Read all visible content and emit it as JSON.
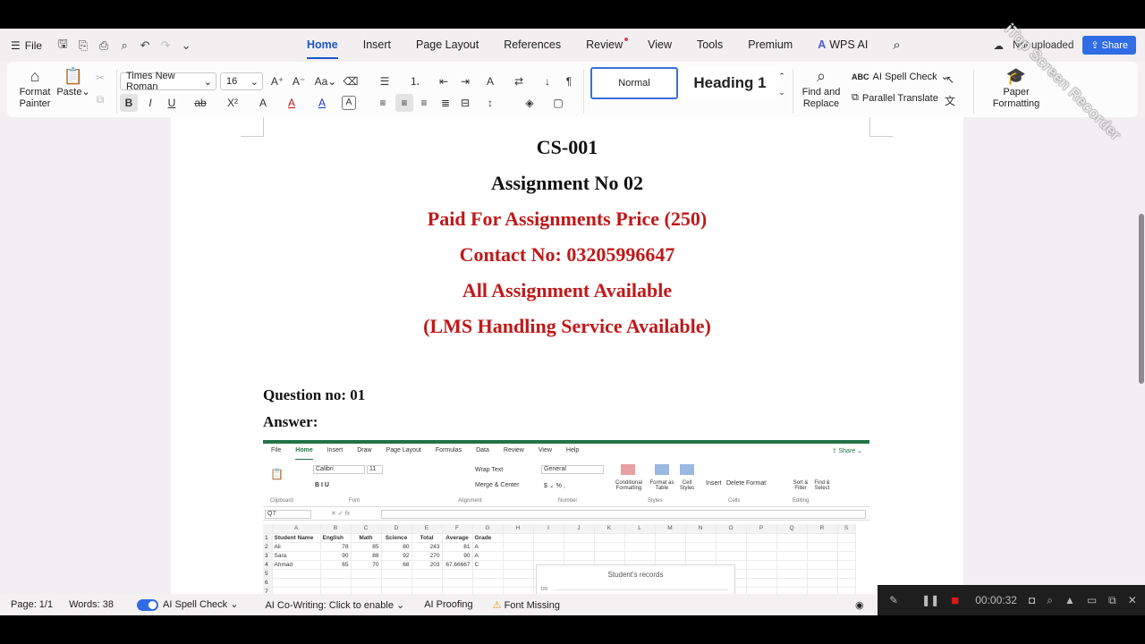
{
  "menubar": {
    "file_label": "File",
    "tabs": [
      "Home",
      "Insert",
      "Page Layout",
      "References",
      "Review",
      "View",
      "Tools",
      "Premium"
    ],
    "wps_ai": "WPS AI",
    "cloud_status": "Not uploaded",
    "share_label": "Share"
  },
  "ribbon": {
    "format_painter": "Format Painter",
    "paste": "Paste",
    "font_name": "Times New Roman",
    "font_size": "16",
    "style_normal": "Normal",
    "style_heading1": "Heading 1",
    "find_replace": "Find and Replace",
    "ai_spell_check": "AI Spell Check",
    "parallel_translate": "Parallel Translate",
    "paper_formatting": "Paper Formatting"
  },
  "document": {
    "lines": [
      {
        "text": "CS-001",
        "color": "#111111"
      },
      {
        "text": "Assignment No 02",
        "color": "#111111"
      },
      {
        "text": "Paid For Assignments Price (250)",
        "color": "#c01818"
      },
      {
        "text": "Contact No: 03205996647",
        "color": "#c01818"
      },
      {
        "text": "All Assignment Available",
        "color": "#c01818"
      },
      {
        "text": "(LMS Handling Service Available)",
        "color": "#c01818"
      }
    ],
    "question": "Question no: 01",
    "answer": "Answer:"
  },
  "excel_image": {
    "tabs": [
      "File",
      "Home",
      "Insert",
      "Draw",
      "Page Layout",
      "Formulas",
      "Data",
      "Review",
      "View",
      "Help"
    ],
    "share": "Share",
    "font": "Calibri",
    "size": "11",
    "number_format": "General",
    "wrap_text": "Wrap Text",
    "merge_center": "Merge & Center",
    "conditional": "Conditional Formatting",
    "format_table": "Format as Table",
    "cell_styles": "Cell Styles",
    "insert": "Insert",
    "delete": "Delete",
    "format": "Format",
    "sort_filter": "Sort & Filter",
    "find_select": "Find & Select",
    "group_labels": [
      "Clipboard",
      "Font",
      "Alignment",
      "Number",
      "Styles",
      "Cells",
      "Editing"
    ],
    "name_box": "Q7",
    "fx": "fx",
    "columns": [
      "A",
      "B",
      "C",
      "D",
      "E",
      "F",
      "G",
      "H",
      "I",
      "J",
      "K",
      "L",
      "M",
      "N",
      "O",
      "P",
      "Q",
      "R",
      "S"
    ],
    "rows": [
      [
        "1",
        "Student Name",
        "English",
        "Math",
        "Science",
        "Total",
        "Average",
        "Grade"
      ],
      [
        "2",
        "Ali",
        "78",
        "85",
        "80",
        "243",
        "81",
        "A"
      ],
      [
        "3",
        "Sara",
        "90",
        "88",
        "92",
        "270",
        "90",
        "A"
      ],
      [
        "4",
        "Ahmad",
        "65",
        "70",
        "68",
        "203",
        "67.66667",
        "C"
      ],
      [
        "5",
        "",
        "",
        "",
        "",
        "",
        "",
        ""
      ],
      [
        "6",
        "",
        "",
        "",
        "",
        "",
        "",
        ""
      ],
      [
        "7",
        "",
        "",
        "",
        "",
        "",
        "",
        ""
      ]
    ],
    "chart_title": "Student's records",
    "chart_axis_label": "100"
  },
  "status": {
    "page": "Page: 1/1",
    "words": "Words: 38",
    "ai_spell_check": "AI Spell Check",
    "ai_cowriting": "AI Co-Writing: Click to enable",
    "ai_proofing": "AI Proofing",
    "font_missing": "Font Missing"
  },
  "recorder": {
    "time": "00:00:32",
    "watermark": "iTop Screen Recorder"
  }
}
